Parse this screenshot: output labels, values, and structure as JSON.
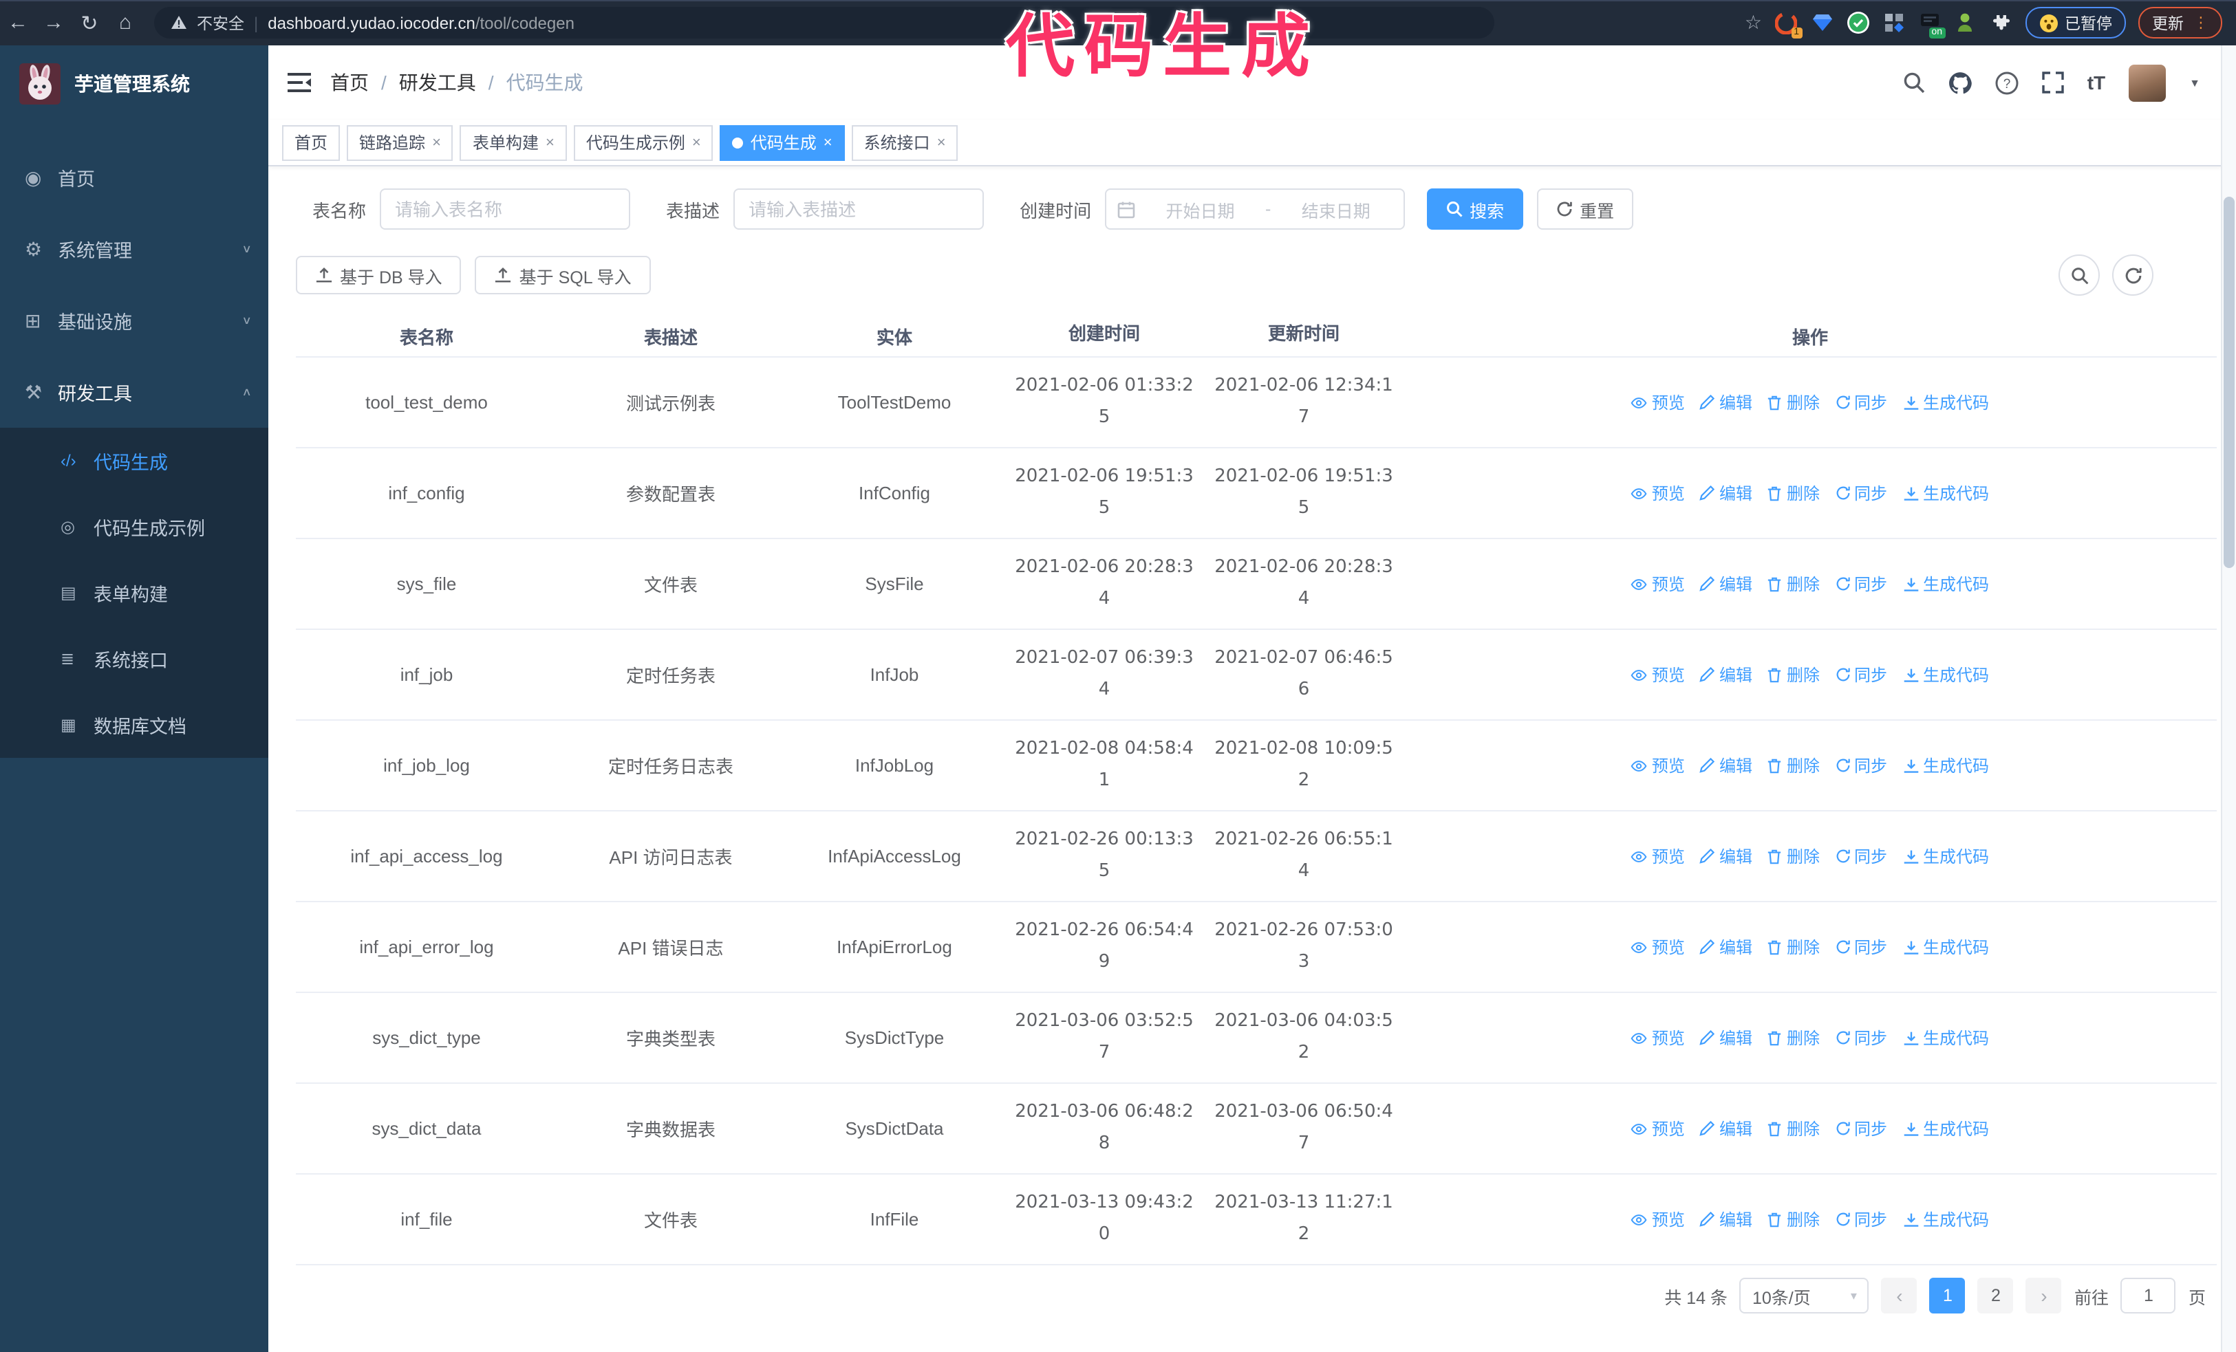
{
  "overlay": {
    "annotation": "代码生成"
  },
  "browser": {
    "icons": {
      "back": "←",
      "forward": "→",
      "reload": "↻",
      "home": "⌂",
      "star": "☆",
      "kebab": "⋮",
      "divider": "|"
    },
    "security_label": "不安全",
    "url_domain": "dashboard.yudao.iocoder.cn",
    "url_path": "/tool/codegen",
    "ext_badge_count": "1",
    "ext_badge_on": "on",
    "paused_label": "已暂停",
    "update_label": "更新"
  },
  "sidebar": {
    "title": "芋道管理系统",
    "items": [
      {
        "name": "sidebar-item-home",
        "label": "首页",
        "icon": "◉",
        "icon_name": "dashboard-icon",
        "chevron": "",
        "class": "mi"
      },
      {
        "name": "sidebar-item-system-mgmt",
        "label": "系统管理",
        "icon": "⚙",
        "icon_name": "gear-icon",
        "chevron": "∨",
        "class": "mi"
      },
      {
        "name": "sidebar-item-infrastructure",
        "label": "基础设施",
        "icon": "⊞",
        "icon_name": "infrastructure-icon",
        "chevron": "∨",
        "class": "mi"
      },
      {
        "name": "sidebar-item-dev-tools",
        "label": "研发工具",
        "icon": "⚒",
        "icon_name": "dev-tools-icon",
        "chevron": "∧",
        "class": "mi open"
      },
      {
        "name": "sidebar-item-codegen",
        "label": "代码生成",
        "icon": "‹/›",
        "icon_name": "code-icon",
        "chevron": "",
        "class": "mi sub active"
      },
      {
        "name": "sidebar-item-codegen-example",
        "label": "代码生成示例",
        "icon": "◎",
        "icon_name": "example-icon",
        "chevron": "",
        "class": "mi sub"
      },
      {
        "name": "sidebar-item-form-build",
        "label": "表单构建",
        "icon": "▤",
        "icon_name": "form-build-icon",
        "chevron": "",
        "class": "mi sub"
      },
      {
        "name": "sidebar-item-system-api",
        "label": "系统接口",
        "icon": "≣",
        "icon_name": "api-icon",
        "chevron": "",
        "class": "mi sub"
      },
      {
        "name": "sidebar-item-db-doc",
        "label": "数据库文档",
        "icon": "▦",
        "icon_name": "db-doc-icon",
        "chevron": "",
        "class": "mi sub"
      }
    ]
  },
  "header": {
    "breadcrumb": [
      {
        "label": "首页",
        "class": "crumb",
        "name": "breadcrumb-home",
        "inter": "true"
      },
      {
        "label": "/",
        "class": "sep",
        "name": "breadcrumb-separator",
        "inter": "false"
      },
      {
        "label": "研发工具",
        "class": "crumb",
        "name": "breadcrumb-dev-tools",
        "inter": "true"
      },
      {
        "label": "/",
        "class": "sep",
        "name": "breadcrumb-separator",
        "inter": "false"
      },
      {
        "label": "代码生成",
        "class": "crumb current",
        "name": "breadcrumb-codegen",
        "inter": "false"
      }
    ],
    "caret": "▼"
  },
  "tabs": [
    {
      "name": "tab-home",
      "label": "首页",
      "close": "",
      "class": "tab"
    },
    {
      "name": "tab-trace",
      "label": "链路追踪",
      "close": "×",
      "class": "tab"
    },
    {
      "name": "tab-form-build",
      "label": "表单构建",
      "close": "×",
      "class": "tab"
    },
    {
      "name": "tab-codegen-example",
      "label": "代码生成示例",
      "close": "×",
      "class": "tab"
    },
    {
      "name": "tab-codegen",
      "label": "代码生成",
      "close": "×",
      "class": "tab active"
    },
    {
      "name": "tab-system-api",
      "label": "系统接口",
      "close": "×",
      "class": "tab"
    }
  ],
  "filters": {
    "name_label": "表名称",
    "name_placeholder": "请输入表名称",
    "desc_label": "表描述",
    "desc_placeholder": "请输入表描述",
    "time_label": "创建时间",
    "start_placeholder": "开始日期",
    "range_separator": "-",
    "end_placeholder": "结束日期",
    "search_label": "搜索",
    "reset_label": "重置"
  },
  "toolbar": {
    "db_import_label": "基于 DB 导入",
    "sql_import_label": "基于 SQL 导入"
  },
  "table": {
    "columns": [
      "表名称",
      "表描述",
      "实体",
      "创建时间",
      "更新时间",
      "操作"
    ],
    "actions": [
      "预览",
      "编辑",
      "删除",
      "同步",
      "生成代码"
    ],
    "rows": [
      {
        "name": "tool_test_demo",
        "desc": "测试示例表",
        "entity": "ToolTestDemo",
        "created": "2021-02-06 01:33:25",
        "updated": "2021-02-06 12:34:17"
      },
      {
        "name": "inf_config",
        "desc": "参数配置表",
        "entity": "InfConfig",
        "created": "2021-02-06 19:51:35",
        "updated": "2021-02-06 19:51:35"
      },
      {
        "name": "sys_file",
        "desc": "文件表",
        "entity": "SysFile",
        "created": "2021-02-06 20:28:34",
        "updated": "2021-02-06 20:28:34"
      },
      {
        "name": "inf_job",
        "desc": "定时任务表",
        "entity": "InfJob",
        "created": "2021-02-07 06:39:34",
        "updated": "2021-02-07 06:46:56"
      },
      {
        "name": "inf_job_log",
        "desc": "定时任务日志表",
        "entity": "InfJobLog",
        "created": "2021-02-08 04:58:41",
        "updated": "2021-02-08 10:09:52"
      },
      {
        "name": "inf_api_access_log",
        "desc": "API 访问日志表",
        "entity": "InfApiAccessLog",
        "created": "2021-02-26 00:13:35",
        "updated": "2021-02-26 06:55:14"
      },
      {
        "name": "inf_api_error_log",
        "desc": "API 错误日志",
        "entity": "InfApiErrorLog",
        "created": "2021-02-26 06:54:49",
        "updated": "2021-02-26 07:53:03"
      },
      {
        "name": "sys_dict_type",
        "desc": "字典类型表",
        "entity": "SysDictType",
        "created": "2021-03-06 03:52:57",
        "updated": "2021-03-06 04:03:52"
      },
      {
        "name": "sys_dict_data",
        "desc": "字典数据表",
        "entity": "SysDictData",
        "created": "2021-03-06 06:48:28",
        "updated": "2021-03-06 06:50:47"
      },
      {
        "name": "inf_file",
        "desc": "文件表",
        "entity": "InfFile",
        "created": "2021-03-13 09:43:20",
        "updated": "2021-03-13 11:27:12"
      }
    ]
  },
  "pagination": {
    "total": "共 14 条",
    "page_size": "10条/页",
    "size_caret": "▾",
    "prev": "‹",
    "next": "›",
    "pages": [
      {
        "label": "1",
        "class": "pg active",
        "name": "page-1"
      },
      {
        "label": "2",
        "class": "pg",
        "name": "page-2"
      }
    ],
    "goto_label": "前往",
    "goto_value": "1",
    "unit_label": "页"
  }
}
